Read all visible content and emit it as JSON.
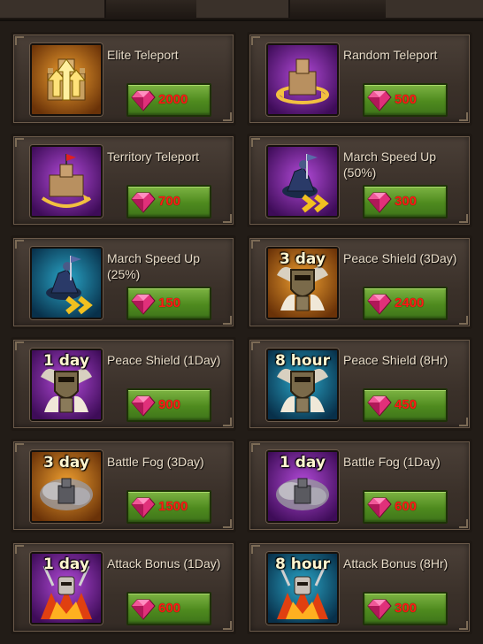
{
  "items": [
    {
      "name": "Elite Teleport",
      "price": "2000",
      "icon": "elite-teleport-icon",
      "tag": "",
      "theme": "orange"
    },
    {
      "name": "Random Teleport",
      "price": "500",
      "icon": "random-teleport-icon",
      "tag": "",
      "theme": "purple"
    },
    {
      "name": "Territory Teleport",
      "price": "700",
      "icon": "territory-teleport-icon",
      "tag": "",
      "theme": "purple"
    },
    {
      "name": "March Speed Up (50%)",
      "price": "300",
      "icon": "march-speed-icon",
      "tag": "",
      "theme": "purple"
    },
    {
      "name": "March Speed Up (25%)",
      "price": "150",
      "icon": "march-speed-icon",
      "tag": "",
      "theme": "blue"
    },
    {
      "name": "Peace Shield (3Day)",
      "price": "2400",
      "icon": "peace-shield-icon",
      "tag": "3 day",
      "theme": "orange"
    },
    {
      "name": "Peace Shield (1Day)",
      "price": "900",
      "icon": "peace-shield-icon",
      "tag": "1 day",
      "theme": "purple"
    },
    {
      "name": "Peace Shield (8Hr)",
      "price": "450",
      "icon": "peace-shield-icon",
      "tag": "8 hour",
      "theme": "blue"
    },
    {
      "name": "Battle Fog (3Day)",
      "price": "1500",
      "icon": "battle-fog-icon",
      "tag": "3 day",
      "theme": "orange"
    },
    {
      "name": "Battle Fog (1Day)",
      "price": "600",
      "icon": "battle-fog-icon",
      "tag": "1 day",
      "theme": "purple"
    },
    {
      "name": "Attack Bonus (1Day)",
      "price": "600",
      "icon": "attack-bonus-icon",
      "tag": "1 day",
      "theme": "purple"
    },
    {
      "name": "Attack Bonus (8Hr)",
      "price": "300",
      "icon": "attack-bonus-icon",
      "tag": "8 hour",
      "theme": "blue"
    }
  ],
  "colors": {
    "orange": [
      "#f0a030",
      "#6a3208"
    ],
    "purple": [
      "#b24ad8",
      "#3e0c58"
    ],
    "blue": [
      "#2aa6c8",
      "#08304a"
    ],
    "price_text": "#ff1a14",
    "buy_button": "#4e8a1e"
  }
}
